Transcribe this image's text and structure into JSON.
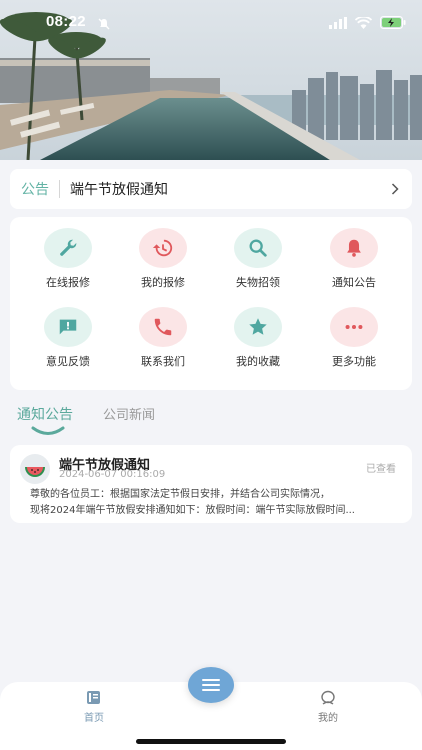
{
  "status_bar": {
    "time": "08:22"
  },
  "notice": {
    "tag": "公告",
    "text": "端午节放假通知"
  },
  "grid": {
    "items": [
      {
        "label": "在线报修",
        "icon": "wrench-icon",
        "tone": "teal"
      },
      {
        "label": "我的报修",
        "icon": "history-icon",
        "tone": "pink"
      },
      {
        "label": "失物招领",
        "icon": "search-icon",
        "tone": "teal"
      },
      {
        "label": "通知公告",
        "icon": "bell-icon",
        "tone": "pink"
      },
      {
        "label": "意见反馈",
        "icon": "feedback-icon",
        "tone": "teal"
      },
      {
        "label": "联系我们",
        "icon": "phone-icon",
        "tone": "pink"
      },
      {
        "label": "我的收藏",
        "icon": "star-icon",
        "tone": "teal"
      },
      {
        "label": "更多功能",
        "icon": "more-icon",
        "tone": "pink"
      }
    ]
  },
  "tabs": {
    "active": "通知公告",
    "inactive": "公司新闻"
  },
  "news": {
    "title": "端午节放假通知",
    "date": "2024-06-07 00:16:09",
    "status": "已查看",
    "body_line1": "尊敬的各位员工：根据国家法定节假日安排，并结合公司实际情况，",
    "body_line2": "现将2024年端午节放假安排通知如下：放假时间：端午节实际放假时间..."
  },
  "bottom_nav": {
    "home": "首页",
    "me": "我的"
  },
  "colors": {
    "accent": "#63b3a5",
    "icon_teal": "#4fa7a0",
    "icon_red": "#e0585c",
    "fab": "#6fa6d6"
  }
}
